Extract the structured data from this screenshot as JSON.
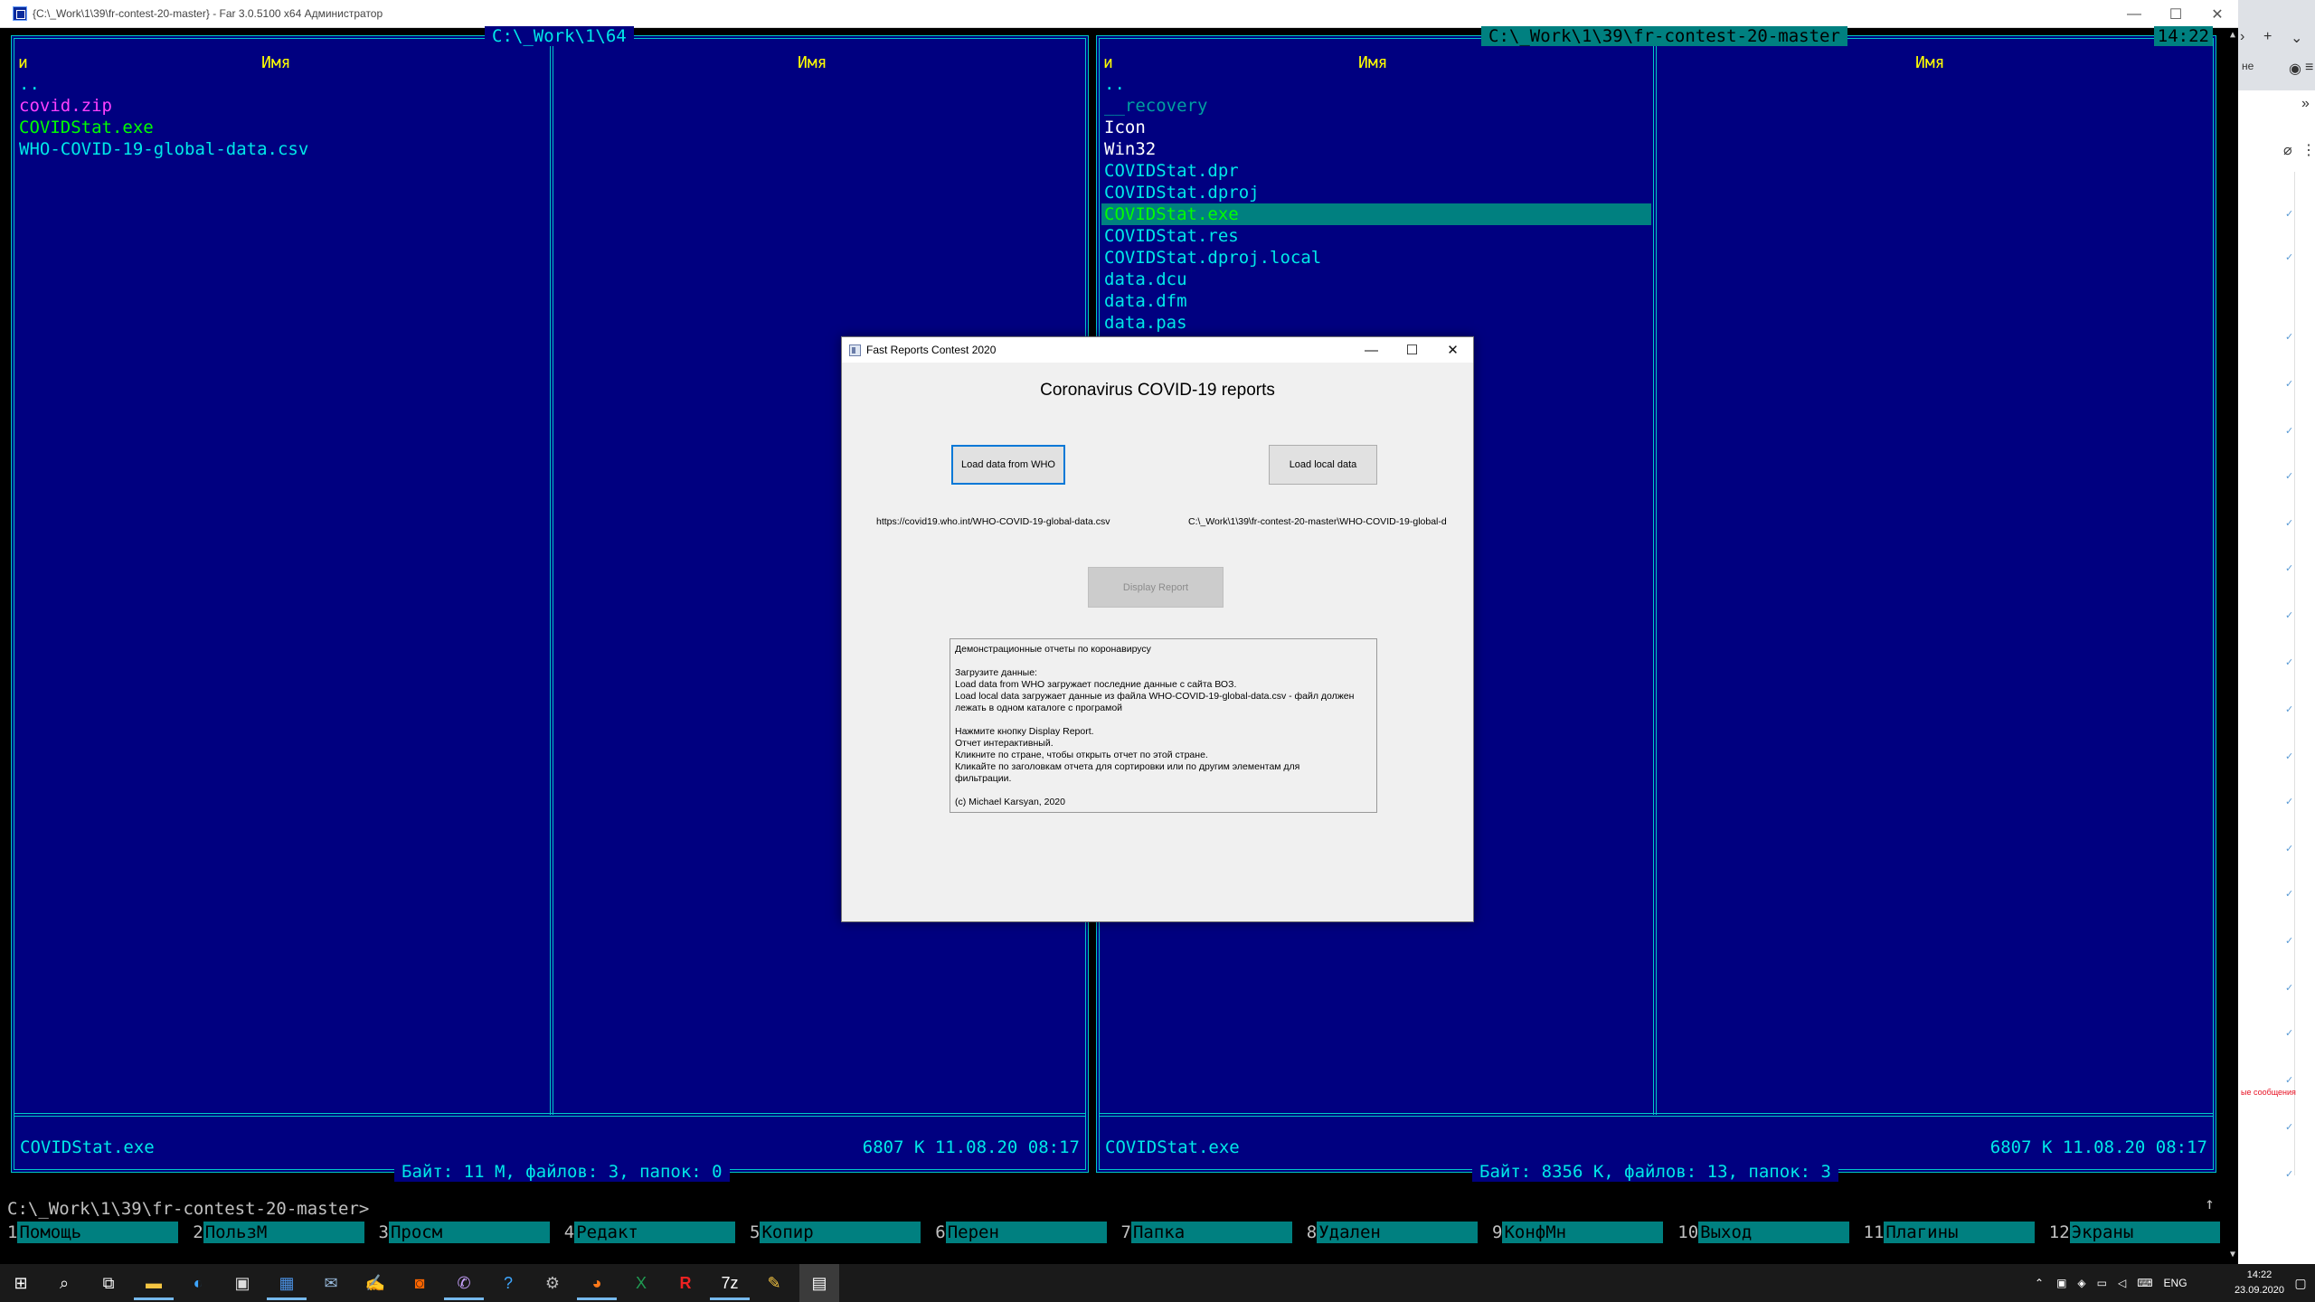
{
  "window": {
    "title": "{C:\\_Work\\1\\39\\fr-contest-20-master} - Far 3.0.5100 x64 Администратор",
    "controls": [
      "—",
      "☐",
      "✕"
    ]
  },
  "left_panel": {
    "path": "C:\\_Work\\1\\64",
    "col_n": "и",
    "col_name1": "Имя",
    "col_name2": "Имя",
    "files": [
      {
        "name": "..",
        "type": "dir"
      },
      {
        "name": "covid.zip",
        "type": "zip"
      },
      {
        "name": "COVIDStat.exe",
        "type": "exe"
      },
      {
        "name": "WHO-COVID-19-global-data.csv",
        "type": "csv"
      }
    ],
    "status_name": "COVIDStat.exe",
    "status_info": "6807 K 11.08.20 08:17",
    "summary": "Байт: 11 М, файлов: 3, папок: 0"
  },
  "right_panel": {
    "path": "C:\\_Work\\1\\39\\fr-contest-20-master",
    "clock": "14:22",
    "col_n": "и",
    "col_name1": "Имя",
    "col_name2": "Имя",
    "files": [
      {
        "name": "..",
        "type": "dir"
      },
      {
        "name": "__recovery",
        "type": "hidden"
      },
      {
        "name": "Icon",
        "type": "white"
      },
      {
        "name": "Win32",
        "type": "white"
      },
      {
        "name": "COVIDStat.dpr",
        "type": "file"
      },
      {
        "name": "COVIDStat.dproj",
        "type": "file"
      },
      {
        "name": "COVIDStat.exe",
        "type": "exe",
        "selected": true
      },
      {
        "name": "COVIDStat.res",
        "type": "file"
      },
      {
        "name": "COVIDStat.dproj.local",
        "type": "file"
      },
      {
        "name": "data.dcu",
        "type": "file"
      },
      {
        "name": "data.dfm",
        "type": "file"
      },
      {
        "name": "data.pas",
        "type": "file"
      }
    ],
    "status_name": "COVIDStat.exe",
    "status_info": "6807 K 11.08.20 08:17",
    "summary": "Байт: 8356 K, файлов: 13, папок: 3"
  },
  "command_line": "C:\\_Work\\1\\39\\fr-contest-20-master>",
  "fkeys": [
    {
      "num": "1",
      "label": "Помощь"
    },
    {
      "num": "2",
      "label": "ПользМ"
    },
    {
      "num": "3",
      "label": "Просм"
    },
    {
      "num": "4",
      "label": "Редакт"
    },
    {
      "num": "5",
      "label": "Копир"
    },
    {
      "num": "6",
      "label": "Перен"
    },
    {
      "num": "7",
      "label": "Папка"
    },
    {
      "num": "8",
      "label": "Удален"
    },
    {
      "num": "9",
      "label": "КонфМн"
    },
    {
      "num": "10",
      "label": "Выход"
    },
    {
      "num": "11",
      "label": "Плагины"
    },
    {
      "num": "12",
      "label": "Экраны"
    }
  ],
  "dialog": {
    "title": "Fast Reports Contest 2020",
    "heading": "Coronavirus COVID-19 reports",
    "btn_load_who": "Load data from WHO",
    "btn_load_local": "Load local data",
    "who_url": "https://covid19.who.int/WHO-COVID-19-global-data.csv",
    "local_path": "C:\\_Work\\1\\39\\fr-contest-20-master\\WHO-COVID-19-global-d",
    "btn_display": "Display Report",
    "memo": [
      "Демонстрационные отчеты по коронавирусу",
      "",
      "Загрузите данные:",
      "Load data from WHO загружает последние данные с сайта ВОЗ.",
      "Load local data загружает данные из файла WHO-COVID-19-global-data.csv - файл должен",
      "лежать в одном каталоге с програмой",
      "",
      "Нажмите кнопку Display Report.",
      "Отчет интерактивный.",
      "Кликните по стране, чтобы открыть отчет по этой стране.",
      "Кликайте по заголовкам отчета для сортировки или по другим элементам для",
      "фильтрации.",
      "",
      "(c) Michael Karsyan, 2020"
    ]
  },
  "background_window": {
    "lang_snippet": "не",
    "red_text": "ые сообщения"
  },
  "taskbar": {
    "tray_lang": "ENG",
    "time": "14:22",
    "date": "23.09.2020"
  }
}
